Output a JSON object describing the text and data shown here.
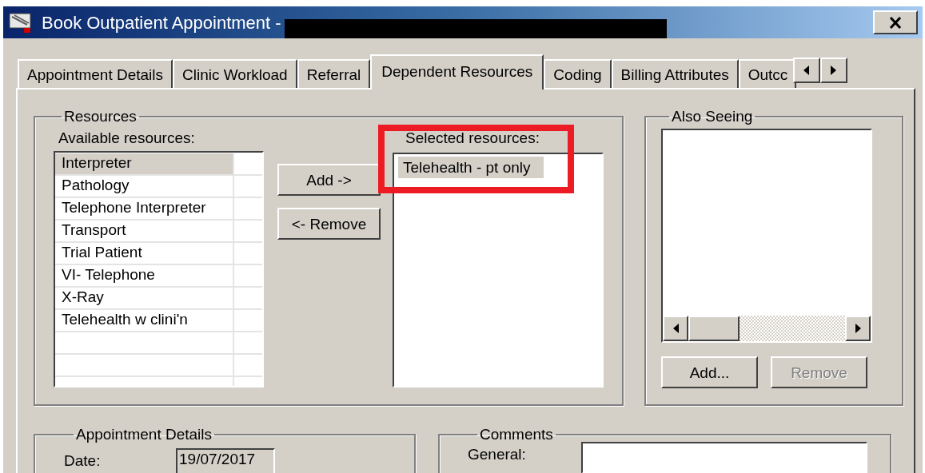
{
  "window": {
    "title": "Book Outpatient Appointment -"
  },
  "tabs": [
    {
      "label": "Appointment Details",
      "selected": false
    },
    {
      "label": "Clinic Workload",
      "selected": false
    },
    {
      "label": "Referral",
      "selected": false
    },
    {
      "label": "Dependent Resources",
      "selected": true
    },
    {
      "label": "Coding",
      "selected": false
    },
    {
      "label": "Billing Attributes",
      "selected": false
    },
    {
      "label": "Outcc",
      "selected": false
    }
  ],
  "resources": {
    "label": "Resources",
    "available_label": "Available resources:",
    "available": [
      {
        "label": "Interpreter",
        "selected": true
      },
      {
        "label": "Pathology",
        "selected": false
      },
      {
        "label": "Telephone Interpreter",
        "selected": false
      },
      {
        "label": "Transport",
        "selected": false
      },
      {
        "label": "Trial Patient",
        "selected": false
      },
      {
        "label": "VI- Telephone",
        "selected": false
      },
      {
        "label": "X-Ray",
        "selected": false
      },
      {
        "label": "Telehealth w clini'n",
        "selected": false
      }
    ],
    "buttons": [
      {
        "label": "Add ->",
        "disabled": false
      },
      {
        "label": "<- Remove",
        "disabled": false
      }
    ],
    "selected_label": "Selected resources:",
    "selected_items": [
      {
        "label": "Telehealth - pt only",
        "selected": true
      }
    ]
  },
  "also_seeing": {
    "label": "Also Seeing",
    "buttons": [
      {
        "label": "Add...",
        "disabled": false
      },
      {
        "label": "Remove",
        "disabled": true
      }
    ]
  },
  "appointment_details": {
    "label": "Appointment Details",
    "fields": [
      {
        "label": "Date:",
        "value": "19/07/2017",
        "read_only": true
      }
    ]
  },
  "comments": {
    "label": "Comments",
    "fields": [
      {
        "label": "General:",
        "read_only": false
      }
    ]
  }
}
